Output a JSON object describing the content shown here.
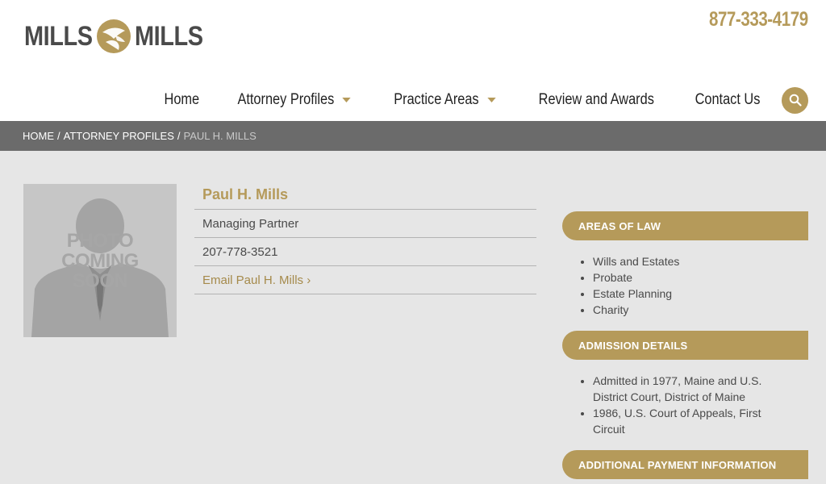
{
  "brand": {
    "logo_left": "MILLS",
    "logo_right": "MILLS",
    "phone": "877-333-4179",
    "accent_color": "#b59a5a",
    "dark_color": "#4a4a4a"
  },
  "nav": {
    "items": [
      {
        "label": "Home",
        "has_dropdown": false
      },
      {
        "label": "Attorney Profiles",
        "has_dropdown": true
      },
      {
        "label": "Practice Areas",
        "has_dropdown": true
      },
      {
        "label": "Review and Awards",
        "has_dropdown": false
      },
      {
        "label": "Contact Us",
        "has_dropdown": false
      }
    ],
    "search_icon": "search-icon"
  },
  "breadcrumb": {
    "home": "HOME",
    "sep1": "/",
    "parent": "ATTORNEY PROFILES",
    "sep2": "/",
    "current": "PAUL H. MILLS"
  },
  "photo": {
    "line1": "PHOTO",
    "line2": "COMING",
    "line3": "SOON"
  },
  "profile": {
    "name": "Paul H. Mills",
    "title": "Managing Partner",
    "phone": "207-778-3521",
    "email_link": "Email Paul H. Mills ›"
  },
  "sidebar": {
    "sections": [
      {
        "heading": "AREAS OF LAW",
        "items": [
          "Wills and Estates",
          "Probate",
          "Estate Planning",
          "Charity"
        ]
      },
      {
        "heading": "ADMISSION DETAILS",
        "items": [
          "Admitted in 1977, Maine and U.S. District Court, District of Maine",
          "1986, U.S. Court of Appeals, First Circuit"
        ]
      },
      {
        "heading": "ADDITIONAL PAYMENT INFORMATION",
        "items": []
      }
    ]
  }
}
